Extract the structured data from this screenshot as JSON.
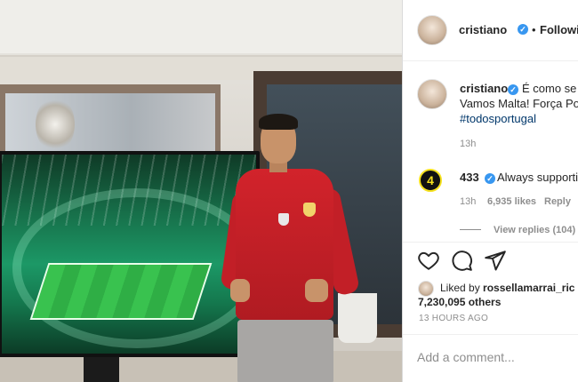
{
  "header": {
    "username": "cristiano",
    "follow_separator": "•",
    "follow_status": "Following"
  },
  "caption": {
    "username": "cristiano",
    "line1": "É como se",
    "line2": "Vamos Malta! Força Po",
    "hashtag": "#todosportugal",
    "time": "13h"
  },
  "comment": {
    "avatar_text": "4",
    "username": "433",
    "text": "Always supporti",
    "time": "13h",
    "likes": "6,935 likes",
    "reply": "Reply",
    "view_replies": "View replies (104)"
  },
  "likes": {
    "liked_by_prefix": "Liked by",
    "liked_by_user": "rossellamarrai_ric",
    "count": "7,230,095 others"
  },
  "timestamp": "13 HOURS AGO",
  "comment_input": {
    "placeholder": "Add a comment..."
  },
  "icons": [
    "heart-icon",
    "comment-icon",
    "share-icon",
    "verified-icon"
  ],
  "colors": {
    "verified": "#3897f0",
    "hashtag": "#00376b",
    "muted": "#8e8e8e",
    "text": "#262626"
  }
}
